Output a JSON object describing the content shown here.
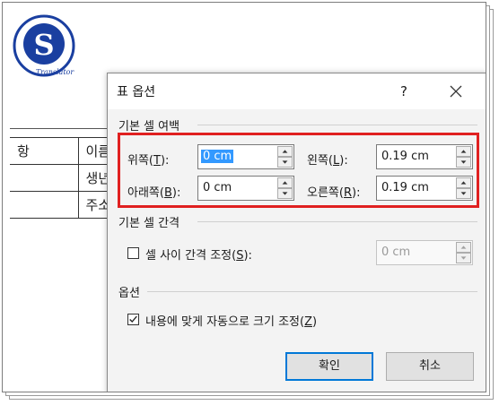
{
  "logo": {
    "letter": "S",
    "caption": "Translator",
    "color": "#1a3fa0"
  },
  "document": {
    "rows": [
      [
        "항",
        "이름"
      ],
      [
        "",
        "생년"
      ],
      [
        "",
        "주소"
      ]
    ]
  },
  "dialog": {
    "title": "표 옵션",
    "help_label": "?",
    "close_icon": "close-icon",
    "default_cell_margins": {
      "label": "기본 셀 여백",
      "top": {
        "label_prefix": "위쪽(",
        "mnemonic": "T",
        "label_suffix": "):",
        "value": "0 cm"
      },
      "bottom": {
        "label_prefix": "아래쪽(",
        "mnemonic": "B",
        "label_suffix": "):",
        "value": "0 cm"
      },
      "left": {
        "label_prefix": "왼쪽(",
        "mnemonic": "L",
        "label_suffix": "):",
        "value": "0.19 cm"
      },
      "right": {
        "label_prefix": "오른쪽(",
        "mnemonic": "R",
        "label_suffix": "):",
        "value": "0.19 cm"
      }
    },
    "default_cell_spacing": {
      "label": "기본 셀 간격",
      "checkbox_prefix": "셀 사이 간격 조정(",
      "checkbox_mnemonic": "S",
      "checkbox_suffix": "):",
      "checked": false,
      "value": "0 cm"
    },
    "options": {
      "label": "옵션",
      "autofit_prefix": "내용에 맞게 자동으로 크기 조정(",
      "autofit_mnemonic": "Z",
      "autofit_suffix": ")",
      "checked": true
    },
    "ok_label": "확인",
    "cancel_label": "취소",
    "highlight_color": "#e02020",
    "accent_color": "#0078d7"
  }
}
